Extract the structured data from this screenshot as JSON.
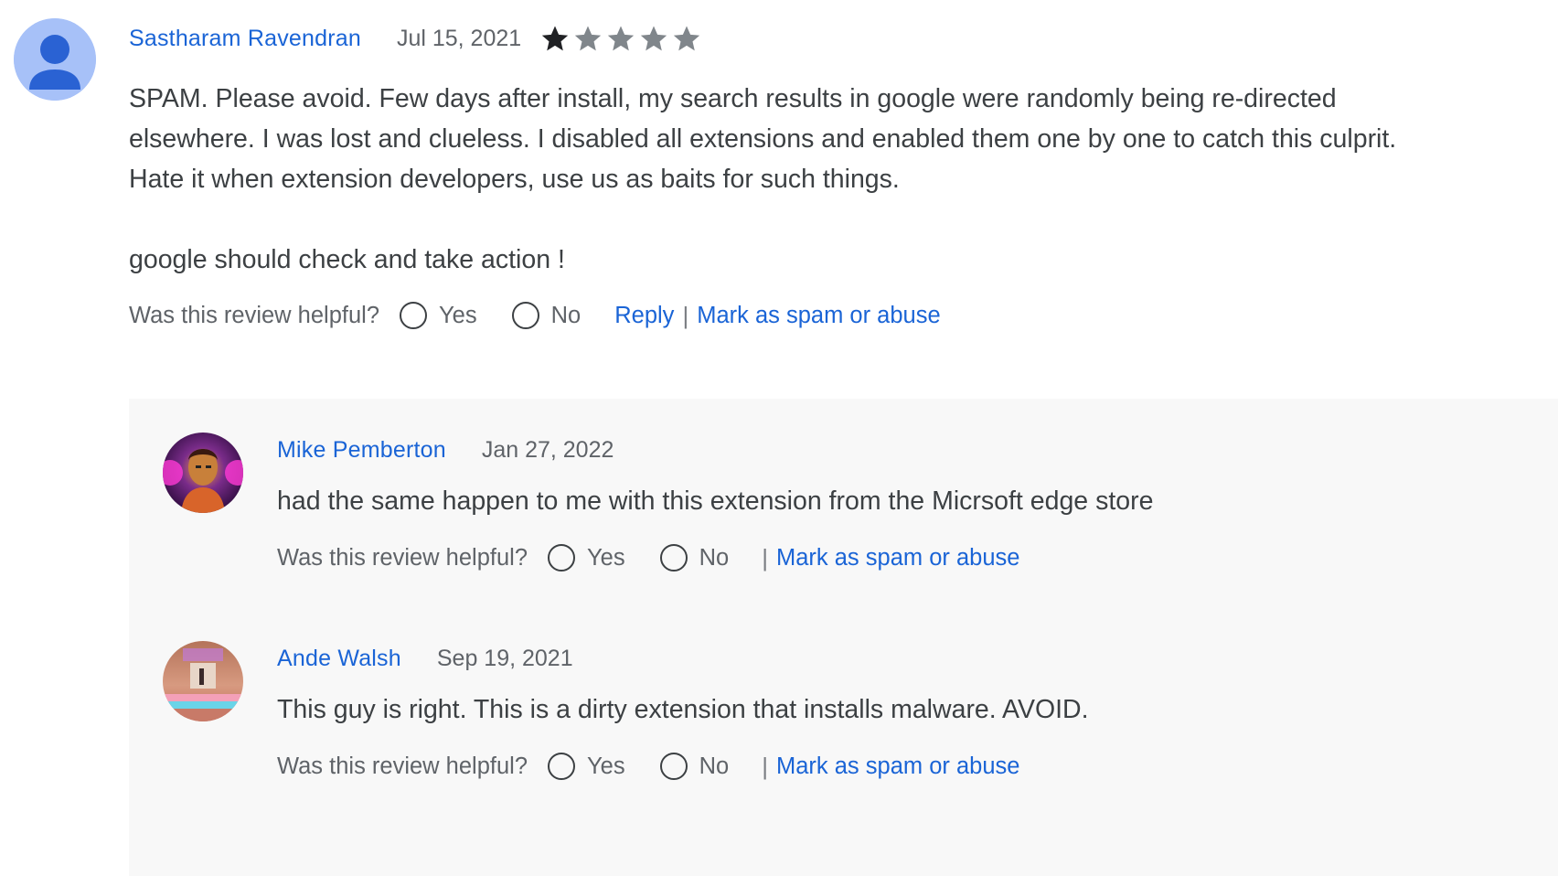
{
  "review": {
    "author": "Sastharam Ravendran",
    "date": "Jul 15, 2021",
    "rating": 1,
    "rating_max": 5,
    "body_paragraphs": [
      "SPAM. Please avoid. Few days after install, my search results in google were randomly being re-directed elsewhere. I was lost and clueless. I disabled all extensions and enabled them one by one to catch this culprit. Hate it when extension developers, use us as baits for such things.",
      "google should check and take action !"
    ],
    "helpful_question": "Was this review helpful?",
    "yes_label": "Yes",
    "no_label": "No",
    "reply_label": "Reply",
    "separator": "|",
    "spam_label": "Mark as spam or abuse",
    "avatar_icon": "default-user-avatar-icon"
  },
  "replies": [
    {
      "author": "Mike Pemberton",
      "date": "Jan 27, 2022",
      "text": "had the same happen to me with this extension from the Micrsoft edge store",
      "helpful_question": "Was this review helpful?",
      "yes_label": "Yes",
      "no_label": "No",
      "separator": "|",
      "spam_label": "Mark as spam or abuse"
    },
    {
      "author": "Ande Walsh",
      "date": "Sep 19, 2021",
      "text": "This guy is right. This is a dirty extension that installs malware. AVOID.",
      "helpful_question": "Was this review helpful?",
      "yes_label": "Yes",
      "no_label": "No",
      "separator": "|",
      "spam_label": "Mark as spam or abuse"
    }
  ],
  "colors": {
    "link": "#1a64d6",
    "star_filled": "#202124",
    "star_empty": "#80868b",
    "reply_background": "#f8f8f8",
    "default_avatar": "#a7c1f8"
  }
}
